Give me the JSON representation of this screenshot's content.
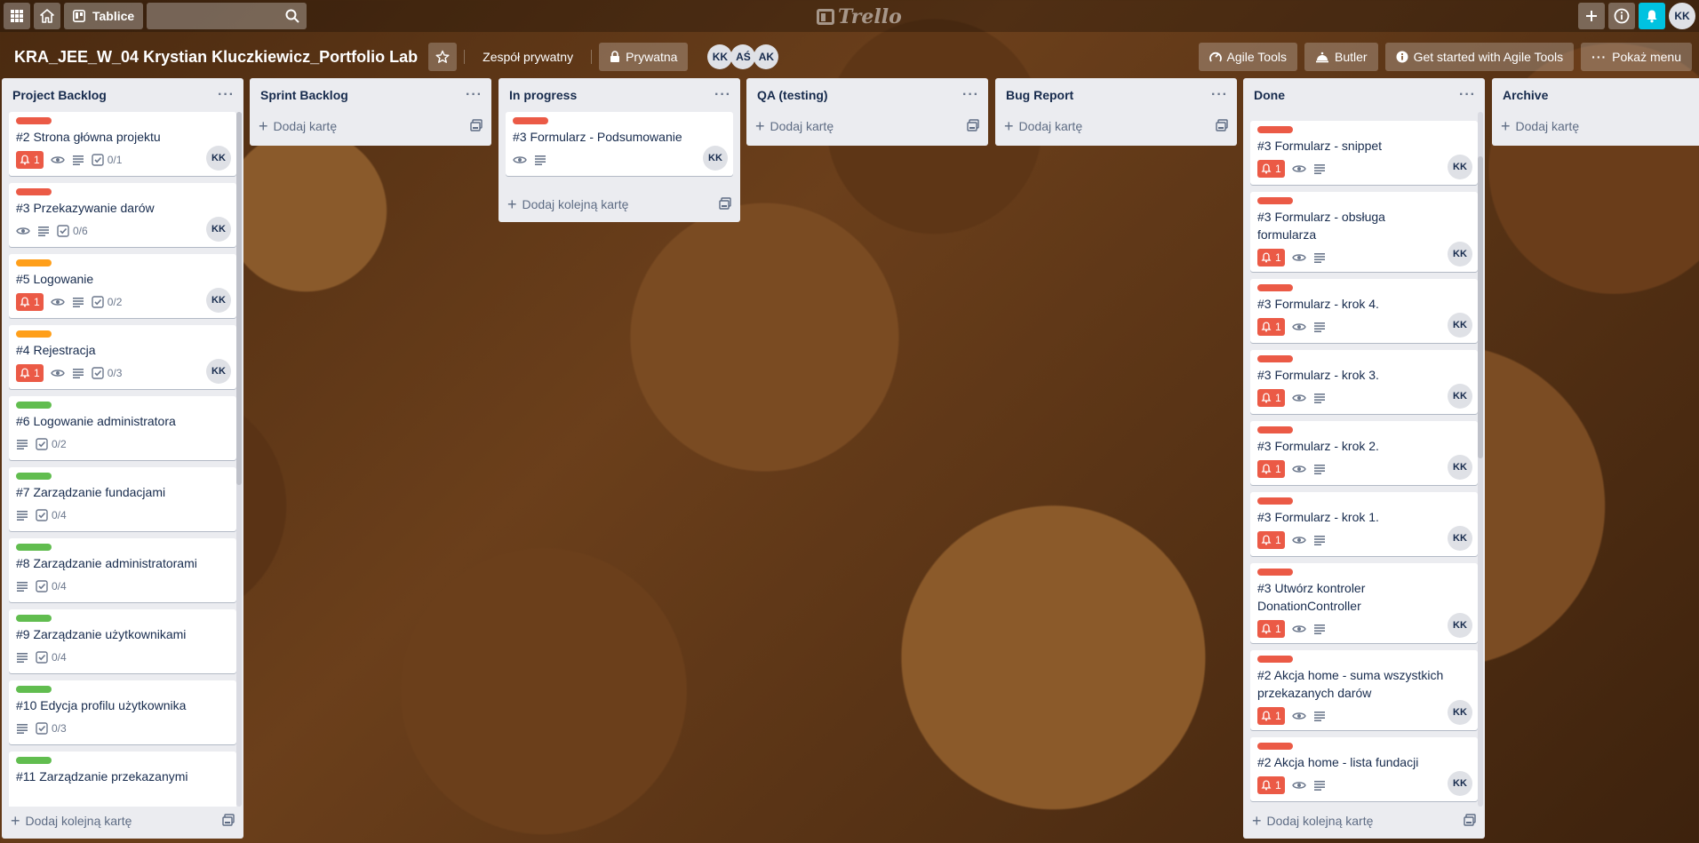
{
  "topbar": {
    "apps_icon": "grid-icon",
    "home_icon": "home-icon",
    "boards_label": "Tablice",
    "search_placeholder": "",
    "logo_text": "Trello",
    "user_initials": "KK"
  },
  "board": {
    "title": "KRA_JEE_W_04 Krystian Kluczkiewicz_Portfolio Lab",
    "team_label": "Zespół prywatny",
    "visibility_label": "Prywatna",
    "members": [
      "KK",
      "AŚ",
      "AK"
    ],
    "agile_tools_label": "Agile Tools",
    "butler_label": "Butler",
    "get_started_label": "Get started with Agile Tools",
    "show_menu_label": "Pokaż menu"
  },
  "colors": {
    "red": "#eb5a46",
    "orange": "#ff9f1a",
    "green": "#61bd4f",
    "notify": "#00c2e0"
  },
  "lists": [
    {
      "title": "Project Backlog",
      "add_label": "Dodaj kolejną kartę",
      "cards": [
        {
          "label": "red",
          "title": "#2 Strona główna projektu",
          "due": "1",
          "watch": true,
          "desc": true,
          "checklist": "0/1",
          "member": "KK"
        },
        {
          "label": "red",
          "title": "#3 Przekazywanie darów",
          "due": "",
          "watch": true,
          "desc": true,
          "checklist": "0/6",
          "member": "KK"
        },
        {
          "label": "orange",
          "title": "#5 Logowanie",
          "due": "1",
          "watch": true,
          "desc": true,
          "checklist": "0/2",
          "member": "KK"
        },
        {
          "label": "orange",
          "title": "#4 Rejestracja",
          "due": "1",
          "watch": true,
          "desc": true,
          "checklist": "0/3",
          "member": "KK"
        },
        {
          "label": "green",
          "title": "#6 Logowanie administratora",
          "due": "",
          "watch": false,
          "desc": true,
          "checklist": "0/2",
          "member": ""
        },
        {
          "label": "green",
          "title": "#7 Zarządzanie fundacjami",
          "due": "",
          "watch": false,
          "desc": true,
          "checklist": "0/4",
          "member": ""
        },
        {
          "label": "green",
          "title": "#8 Zarządzanie administratorami",
          "due": "",
          "watch": false,
          "desc": true,
          "checklist": "0/4",
          "member": ""
        },
        {
          "label": "green",
          "title": "#9 Zarządzanie użytkownikami",
          "due": "",
          "watch": false,
          "desc": true,
          "checklist": "0/4",
          "member": ""
        },
        {
          "label": "green",
          "title": "#10 Edycja profilu użytkownika",
          "due": "",
          "watch": false,
          "desc": true,
          "checklist": "0/3",
          "member": ""
        },
        {
          "label": "green",
          "title": "#11 Zarządzanie przekazanymi",
          "due": "",
          "watch": false,
          "desc": false,
          "checklist": "",
          "member": ""
        }
      ]
    },
    {
      "title": "Sprint Backlog",
      "add_label": "Dodaj kartę",
      "cards": []
    },
    {
      "title": "In progress",
      "add_label": "Dodaj kolejną kartę",
      "cards": [
        {
          "label": "red",
          "title": "#3 Formularz - Podsumowanie",
          "due": "",
          "watch": true,
          "desc": true,
          "checklist": "",
          "member": "KK"
        }
      ]
    },
    {
      "title": "QA (testing)",
      "add_label": "Dodaj kartę",
      "cards": []
    },
    {
      "title": "Bug Report",
      "add_label": "Dodaj kartę",
      "cards": []
    },
    {
      "title": "Done",
      "add_label": "Dodaj kolejną kartę",
      "cards": [
        {
          "label": "red",
          "title": "#3 Formularz - snippet",
          "due": "1",
          "watch": true,
          "desc": true,
          "checklist": "",
          "member": "KK"
        },
        {
          "label": "red",
          "title": "#3 Formularz - obsługa formularza",
          "due": "1",
          "watch": true,
          "desc": true,
          "checklist": "",
          "member": "KK"
        },
        {
          "label": "red",
          "title": "#3 Formularz - krok 4.",
          "due": "1",
          "watch": true,
          "desc": true,
          "checklist": "",
          "member": "KK"
        },
        {
          "label": "red",
          "title": "#3 Formularz - krok 3.",
          "due": "1",
          "watch": true,
          "desc": true,
          "checklist": "",
          "member": "KK"
        },
        {
          "label": "red",
          "title": "#3 Formularz - krok 2.",
          "due": "1",
          "watch": true,
          "desc": true,
          "checklist": "",
          "member": "KK"
        },
        {
          "label": "red",
          "title": "#3 Formularz - krok 1.",
          "due": "1",
          "watch": true,
          "desc": true,
          "checklist": "",
          "member": "KK"
        },
        {
          "label": "red",
          "title": "#3 Utwórz kontroler DonationController",
          "due": "1",
          "watch": true,
          "desc": true,
          "checklist": "",
          "member": "KK"
        },
        {
          "label": "red",
          "title": "#2 Akcja home - suma wszystkich przekazanych darów",
          "due": "1",
          "watch": true,
          "desc": true,
          "checklist": "",
          "member": "KK"
        },
        {
          "label": "red",
          "title": "#2 Akcja home - lista fundacji",
          "due": "1",
          "watch": true,
          "desc": true,
          "checklist": "",
          "member": "KK"
        }
      ]
    },
    {
      "title": "Archive",
      "add_label": "Dodaj kartę",
      "cards": []
    }
  ]
}
